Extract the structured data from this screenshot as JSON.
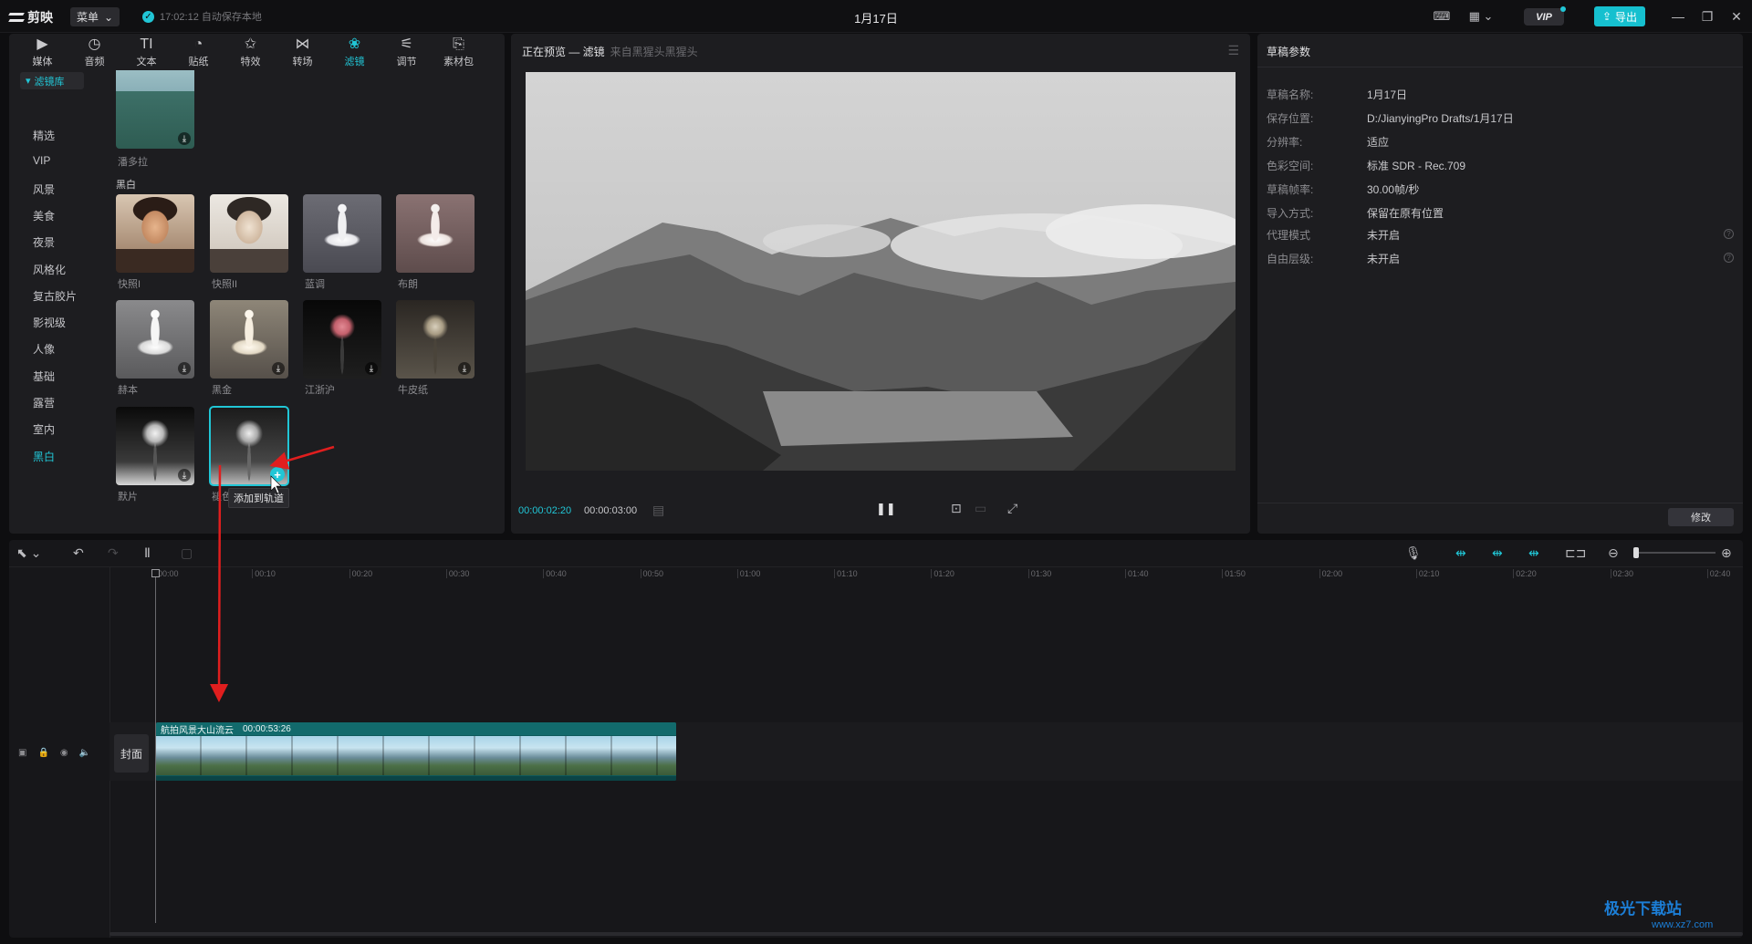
{
  "titlebar": {
    "app_name": "剪映",
    "menu_label": "菜单",
    "autosave_text": "17:02:12 自动保存本地",
    "doc_title": "1月17日",
    "vip_label": "VIP",
    "export_label": "导出"
  },
  "tool_tabs": [
    {
      "label": "媒体",
      "icon": "media-icon",
      "glyph": "▶"
    },
    {
      "label": "音频",
      "icon": "audio-icon",
      "glyph": "◷"
    },
    {
      "label": "文本",
      "icon": "text-icon",
      "glyph": "TI"
    },
    {
      "label": "贴纸",
      "icon": "sticker-icon",
      "glyph": "◔"
    },
    {
      "label": "特效",
      "icon": "effects-icon",
      "glyph": "✩"
    },
    {
      "label": "转场",
      "icon": "transition-icon",
      "glyph": "⋈"
    },
    {
      "label": "滤镜",
      "icon": "filter-icon",
      "glyph": "❀"
    },
    {
      "label": "调节",
      "icon": "adjust-icon",
      "glyph": "⚟"
    },
    {
      "label": "素材包",
      "icon": "package-icon",
      "glyph": "⎘"
    }
  ],
  "active_tab": "滤镜",
  "sidebar": {
    "library_label": "滤镜库",
    "items": [
      "精选",
      "VIP",
      "风景",
      "美食",
      "夜景",
      "风格化",
      "复古胶片",
      "影视级",
      "人像",
      "基础",
      "露营",
      "室内",
      "黑白"
    ],
    "active": "黑白"
  },
  "filters": {
    "top_item": "潘多拉",
    "section_label": "黑白",
    "items": [
      "快照I",
      "快照II",
      "蓝调",
      "布朗",
      "赫本",
      "黑金",
      "江浙沪",
      "牛皮纸",
      "默片",
      "褪色"
    ],
    "tooltip": "添加到轨道"
  },
  "preview": {
    "title": "正在预览 — 滤镜",
    "subtitle": "来自黑猩头黑猩头",
    "current_time": "00:00:02:20",
    "total_time": "00:00:03:00"
  },
  "props": {
    "title": "草稿参数",
    "rows": [
      {
        "label": "草稿名称:",
        "value": "1月17日"
      },
      {
        "label": "保存位置:",
        "value": "D:/JianyingPro Drafts/1月17日"
      },
      {
        "label": "分辨率:",
        "value": "适应"
      },
      {
        "label": "色彩空间:",
        "value": "标准 SDR - Rec.709"
      },
      {
        "label": "草稿帧率:",
        "value": "30.00帧/秒"
      },
      {
        "label": "导入方式:",
        "value": "保留在原有位置"
      }
    ],
    "rows2": [
      {
        "label": "代理模式",
        "value": "未开启"
      },
      {
        "label": "自由层级:",
        "value": "未开启"
      }
    ],
    "modify_label": "修改"
  },
  "timeline": {
    "ticks": [
      "00:00",
      "00:10",
      "00:20",
      "00:30",
      "00:40",
      "00:50",
      "01:00",
      "01:10",
      "01:20",
      "01:30",
      "01:40",
      "01:50",
      "02:00",
      "02:10",
      "02:20",
      "02:30",
      "02:40"
    ],
    "cover_label": "封面",
    "clip_name": "航拍风景大山流云",
    "clip_duration": "00:00:53:26"
  },
  "watermark": {
    "brand": "极光下载站",
    "url": "www.xz7.com"
  }
}
